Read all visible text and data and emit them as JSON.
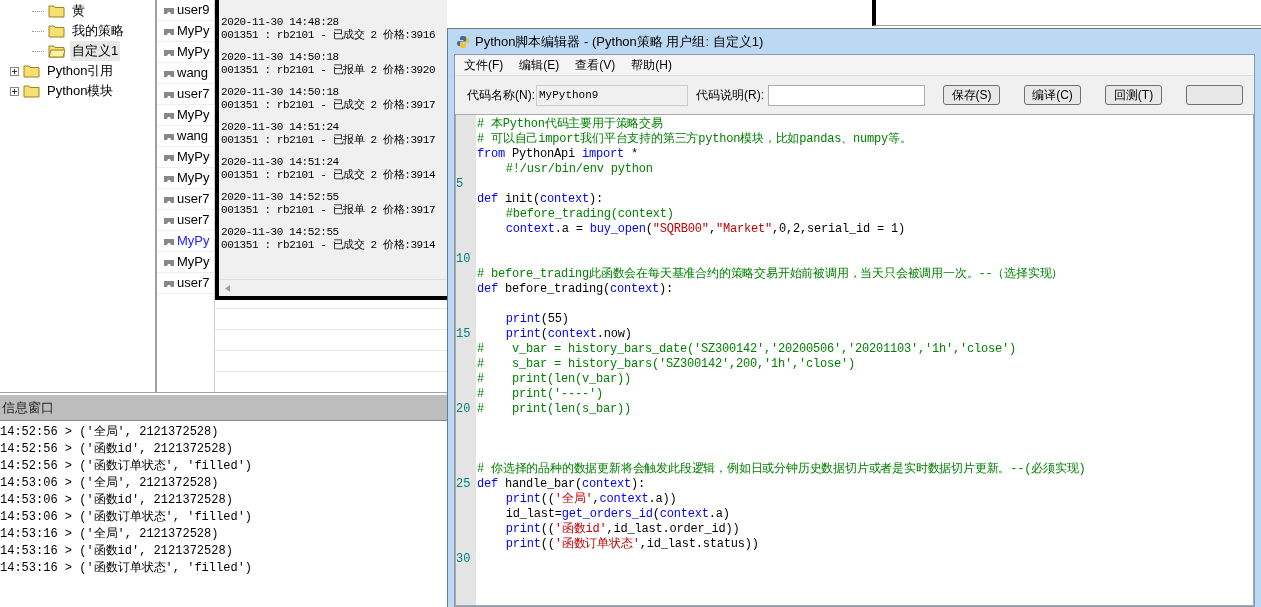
{
  "tree": [
    {
      "children": [
        {
          "label": "黄",
          "selected": false
        },
        {
          "label": "我的策略",
          "selected": false
        },
        {
          "label": "自定义1",
          "selected": true
        }
      ]
    },
    {
      "label": "Python引用",
      "expanded": false,
      "selected": false
    },
    {
      "label": "Python模块",
      "expanded": false,
      "selected": false
    }
  ],
  "strategy_list": [
    {
      "label": "user9",
      "selected": false
    },
    {
      "label": "MyPy",
      "selected": false
    },
    {
      "label": "MyPy",
      "selected": false
    },
    {
      "label": "wang",
      "selected": false
    },
    {
      "label": "user7",
      "selected": false
    },
    {
      "label": "MyPy",
      "selected": false
    },
    {
      "label": "wang",
      "selected": false
    },
    {
      "label": "MyPy",
      "selected": false
    },
    {
      "label": "MyPy",
      "selected": false
    },
    {
      "label": "user7",
      "selected": false
    },
    {
      "label": "user7",
      "selected": false
    },
    {
      "label": "MyPy",
      "selected": true
    },
    {
      "label": "MyPy",
      "selected": false
    },
    {
      "label": "user7",
      "selected": false
    }
  ],
  "order_log": [
    {
      "time": "2020-11-30 14:48:28",
      "text": "001351 : rb2101 - 已成交 2 价格:3916"
    },
    {
      "time": "2020-11-30 14:50:18",
      "text": "001351 : rb2101 - 已报单 2 价格:3920"
    },
    {
      "time": "2020-11-30 14:50:18",
      "text": "001351 : rb2101 - 已成交 2 价格:3917"
    },
    {
      "time": "2020-11-30 14:51:24",
      "text": "001351 : rb2101 - 已报单 2 价格:3917"
    },
    {
      "time": "2020-11-30 14:51:24",
      "text": "001351 : rb2101 - 已成交 2 价格:3914"
    },
    {
      "time": "2020-11-30 14:52:55",
      "text": "001351 : rb2101 - 已报单 2 价格:3917"
    },
    {
      "time": "2020-11-30 14:52:55",
      "text": "001351 : rb2101 - 已成交 2 价格:3914"
    }
  ],
  "info_window": {
    "title": "信息窗口",
    "lines": [
      "14:52:56 > ('全局', 2121372528)",
      "14:52:56 > ('函数id', 2121372528)",
      "14:52:56 > ('函数订单状态', 'filled')",
      "14:53:06 > ('全局', 2121372528)",
      "14:53:06 > ('函数id', 2121372528)",
      "14:53:06 > ('函数订单状态', 'filled')",
      "14:53:16 > ('全局', 2121372528)",
      "14:53:16 > ('函数id', 2121372528)",
      "14:53:16 > ('函数订单状态', 'filled')"
    ]
  },
  "editor": {
    "title": "Python脚本编辑器 - (Python策略 用户组: 自定义1)",
    "menu": [
      "文件(F)",
      "编辑(E)",
      "查看(V)",
      "帮助(H)"
    ],
    "code_name_label": "代码名称(N):",
    "code_name": "MyPython9",
    "code_desc_label": "代码说明(R):",
    "buttons": [
      "保存(S)",
      "编译(C)",
      "回测(T)"
    ],
    "code_lines": [
      {
        "tokens": [
          {
            "t": "# 本Python代码主要用于策略交易",
            "kind": "comment"
          }
        ]
      },
      {
        "tokens": [
          {
            "t": "# 可以自己import我们平台支持的第三方python模块，比如pandas、numpy等。",
            "kind": "comment"
          }
        ]
      },
      {
        "tokens": [
          {
            "t": "from",
            "kind": "keyword"
          },
          {
            "t": " PythonApi ",
            "kind": "text"
          },
          {
            "t": "import",
            "kind": "keyword"
          },
          {
            "t": " *",
            "kind": "text"
          }
        ]
      },
      {
        "indented": true,
        "tokens": [
          {
            "t": "#!/usr/bin/env python",
            "kind": "comment"
          }
        ]
      },
      {
        "number": "5"
      },
      {
        "tokens": [
          {
            "t": "def",
            "kind": "keyword"
          },
          {
            "t": " init(",
            "kind": "text"
          },
          {
            "t": "context",
            "kind": "keyword"
          },
          {
            "t": "):",
            "kind": "text"
          }
        ]
      },
      {
        "indented": true,
        "tokens": [
          {
            "t": "#before_trading(context)",
            "kind": "comment"
          }
        ]
      },
      {
        "indented": true,
        "tokens": [
          {
            "t": "context",
            "kind": "keyword"
          },
          {
            "t": ".a = ",
            "kind": "text"
          },
          {
            "t": "buy_open",
            "kind": "keyword"
          },
          {
            "t": "(",
            "kind": "text"
          },
          {
            "t": "\"SQRB00\"",
            "kind": "string"
          },
          {
            "t": ",",
            "kind": "text"
          },
          {
            "t": "\"Market\"",
            "kind": "string"
          },
          {
            "t": ",0,2,serial_id = 1)",
            "kind": "text"
          }
        ]
      },
      {
        "number": "10"
      },
      {
        "tokens": [
          {
            "t": "# before_trading此函数会在每天基准合约的策略交易开始前被调用，当天只会被调用一次。--（选择实现）",
            "kind": "comment"
          }
        ]
      },
      {
        "tokens": [
          {
            "t": "def",
            "kind": "keyword"
          },
          {
            "t": " before_trading(",
            "kind": "text"
          },
          {
            "t": "context",
            "kind": "keyword"
          },
          {
            "t": "):",
            "kind": "text"
          }
        ]
      },
      {
        "indented": true,
        "tokens": [
          {
            "t": "print",
            "kind": "keyword"
          },
          {
            "t": "(55)",
            "kind": "text"
          }
        ]
      },
      {
        "number": "15",
        "indented": true,
        "tokens": [
          {
            "t": "print",
            "kind": "keyword"
          },
          {
            "t": "(",
            "kind": "text"
          },
          {
            "t": "context",
            "kind": "keyword"
          },
          {
            "t": ".now)",
            "kind": "text"
          }
        ]
      },
      {
        "tokens": [
          {
            "t": "#    v_bar = history_bars_date('SZ300142','20200506','20201103','1h','close')",
            "kind": "comment"
          }
        ]
      },
      {
        "tokens": [
          {
            "t": "#    s_bar = history_bars('SZ300142',200,'1h','close')",
            "kind": "comment"
          }
        ]
      },
      {
        "tokens": [
          {
            "t": "#    print(len(v_bar))",
            "kind": "comment"
          }
        ]
      },
      {
        "tokens": [
          {
            "t": "#    print('----')",
            "kind": "comment"
          }
        ]
      },
      {
        "number": "20",
        "tokens": [
          {
            "t": "#    print(len(s_bar))",
            "kind": "comment"
          }
        ]
      },
      {
        "tokens": [
          {
            "t": "# 你选择的品种的数据更新将会触发此段逻辑，例如日或分钟历史数据切片或者是实时数据切片更新。--(必须实现)",
            "kind": "comment"
          }
        ]
      },
      {
        "number": "25",
        "tokens": [
          {
            "t": "def",
            "kind": "keyword"
          },
          {
            "t": " handle_bar(",
            "kind": "text"
          },
          {
            "t": "context",
            "kind": "keyword"
          },
          {
            "t": "):",
            "kind": "text"
          }
        ]
      },
      {
        "indented": true,
        "tokens": [
          {
            "t": "print",
            "kind": "keyword"
          },
          {
            "t": "((",
            "kind": "text"
          },
          {
            "t": "'全局'",
            "kind": "string"
          },
          {
            "t": ",",
            "kind": "text"
          },
          {
            "t": "context",
            "kind": "keyword"
          },
          {
            "t": ".a))",
            "kind": "text"
          }
        ]
      },
      {
        "indented": true,
        "tokens": [
          {
            "t": "id_last=",
            "kind": "text"
          },
          {
            "t": "get_orders_id",
            "kind": "keyword"
          },
          {
            "t": "(",
            "kind": "text"
          },
          {
            "t": "context",
            "kind": "keyword"
          },
          {
            "t": ".a)",
            "kind": "text"
          }
        ]
      },
      {
        "indented": true,
        "tokens": [
          {
            "t": "print",
            "kind": "keyword"
          },
          {
            "t": "((",
            "kind": "text"
          },
          {
            "t": "'函数id'",
            "kind": "string"
          },
          {
            "t": ",id_last.order_id))",
            "kind": "text"
          }
        ]
      },
      {
        "indented": true,
        "tokens": [
          {
            "t": "print",
            "kind": "keyword"
          },
          {
            "t": "((",
            "kind": "text"
          },
          {
            "t": "'函数订单状态'",
            "kind": "string"
          },
          {
            "t": ",id_last.status))",
            "kind": "text"
          }
        ]
      },
      {
        "number": "30"
      }
    ]
  }
}
